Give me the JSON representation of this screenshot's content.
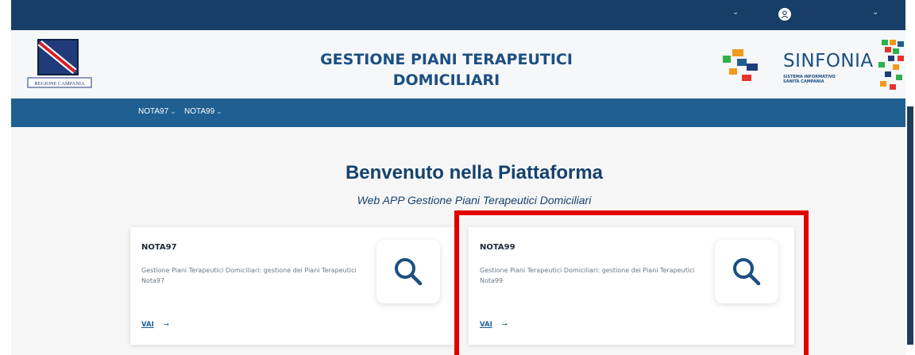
{
  "header": {
    "logo_text": "REGIONE CAMPANIA",
    "title_line1": "GESTIONE PIANI TERAPEUTICI",
    "title_line2": "DOMICILIARI",
    "brand_name": "SINFONIA",
    "brand_sub_line1": "SISTEMA INFORMATIVO",
    "brand_sub_line2": "SANITÀ CAMPANIA"
  },
  "navbar": {
    "items": [
      {
        "label": "NOTA97"
      },
      {
        "label": "NOTA99"
      }
    ]
  },
  "main": {
    "welcome": "Benvenuto nella Piattaforma",
    "subtitle": "Web APP Gestione Piani Terapeutici Domiciliari"
  },
  "cards": [
    {
      "title": "NOTA97",
      "description": "Gestione Piani Terapeutici Domiciliari: gestione dei Piani Terapeutici Nota97",
      "link": "VAI",
      "arrow": "→"
    },
    {
      "title": "NOTA99",
      "description": "Gestione Piani Terapeutici Domiciliari: gestione dei Piani Terapeutici Nota99",
      "link": "VAI",
      "arrow": "→"
    }
  ],
  "icons": {
    "user": "user-icon",
    "search": "search-icon",
    "chevron": "chevron-down-icon"
  },
  "colors": {
    "topbar": "#173e66",
    "navbar": "#1f5f91",
    "title_blue": "#1c4f82",
    "highlight_red": "#e00000"
  }
}
